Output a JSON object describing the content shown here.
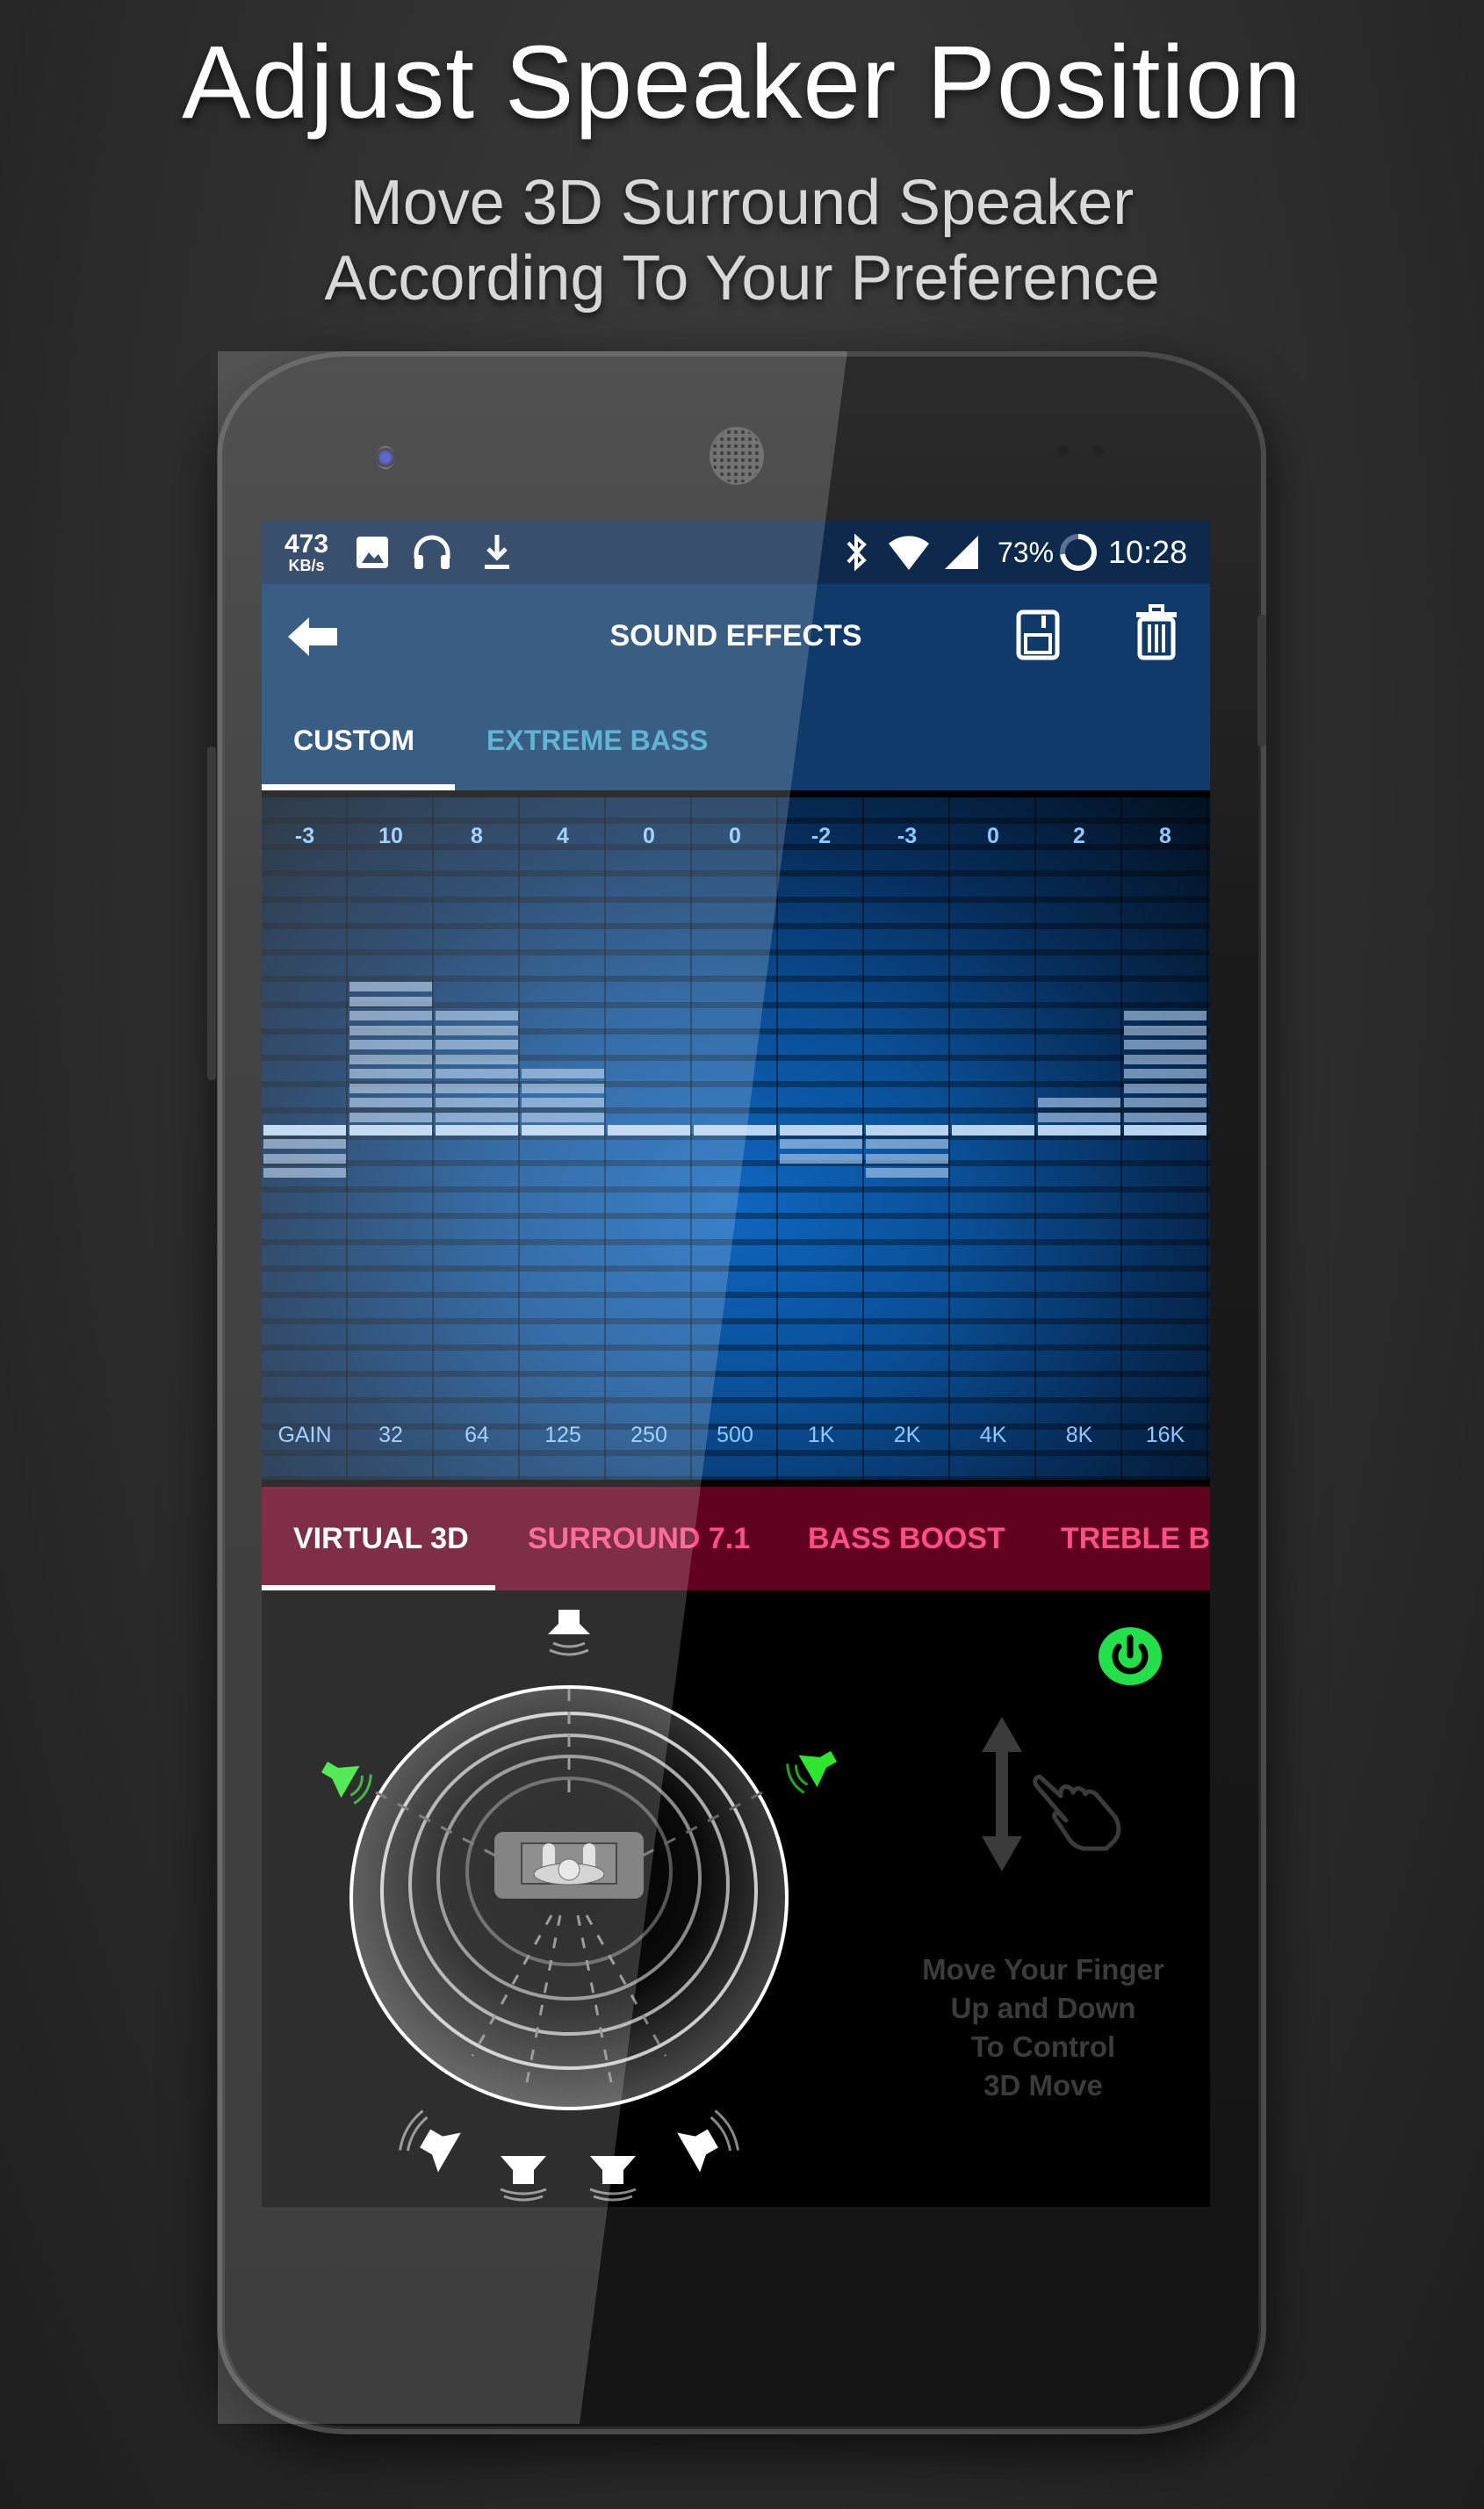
{
  "promo": {
    "headline": "Adjust Speaker Position",
    "subline_1": "Move 3D Surround Speaker",
    "subline_2": "According To Your Preference"
  },
  "status_bar": {
    "net_speed_value": "473",
    "net_speed_unit": "KB/s",
    "left_icons": [
      "image-icon",
      "headphones-icon",
      "download-icon"
    ],
    "right_icons": [
      "bluetooth-icon",
      "wifi-icon",
      "signal-icon"
    ],
    "battery_percent": "73%",
    "battery_level": 0.73,
    "time": "10:28"
  },
  "toolbar": {
    "title": "SOUND EFFECTS",
    "back_icon": "back-arrow-icon",
    "save_icon": "save-icon",
    "delete_icon": "trash-icon"
  },
  "preset_tabs": [
    {
      "label": "CUSTOM",
      "active": true
    },
    {
      "label": "EXTREME BASS",
      "active": false
    }
  ],
  "equalizer": {
    "bands": [
      {
        "label": "GAIN",
        "value": "-3",
        "level": -3
      },
      {
        "label": "32",
        "value": "10",
        "level": 10
      },
      {
        "label": "64",
        "value": "8",
        "level": 8
      },
      {
        "label": "125",
        "value": "4",
        "level": 4
      },
      {
        "label": "250",
        "value": "0",
        "level": 0
      },
      {
        "label": "500",
        "value": "0",
        "level": 0
      },
      {
        "label": "1K",
        "value": "-2",
        "level": -2
      },
      {
        "label": "2K",
        "value": "-3",
        "level": -3
      },
      {
        "label": "4K",
        "value": "0",
        "level": 0
      },
      {
        "label": "8K",
        "value": "2",
        "level": 2
      },
      {
        "label": "16K",
        "value": "8",
        "level": 8
      }
    ],
    "level_range": [
      -15,
      15
    ]
  },
  "effect_tabs": [
    {
      "label": "VIRTUAL 3D",
      "active": true
    },
    {
      "label": "SURROUND 7.1",
      "active": false
    },
    {
      "label": "BASS BOOST",
      "active": false
    },
    {
      "label": "TREBLE BOOST",
      "active": false
    }
  ],
  "virtual3d": {
    "power_on": true,
    "hint_lines": [
      "Move Your Finger",
      "Up and Down",
      "To Control",
      "3D Move"
    ],
    "speakers": [
      {
        "name": "center",
        "active": false
      },
      {
        "name": "front-left",
        "active": true
      },
      {
        "name": "front-right",
        "active": true
      },
      {
        "name": "rear-left",
        "active": false
      },
      {
        "name": "rear-center-left",
        "active": false
      },
      {
        "name": "rear-center-right",
        "active": false
      },
      {
        "name": "rear-right",
        "active": false
      }
    ]
  },
  "colors": {
    "toolbar_blue": "#0f3a6a",
    "eq_label": "#8fc8ff",
    "effect_tabs_bg": "#62011f",
    "effect_tab_inactive": "#ff4f86",
    "preset_tab_inactive": "#3ea6c8",
    "power_green": "#22e04a",
    "active_speaker_green": "#2ee62e"
  }
}
